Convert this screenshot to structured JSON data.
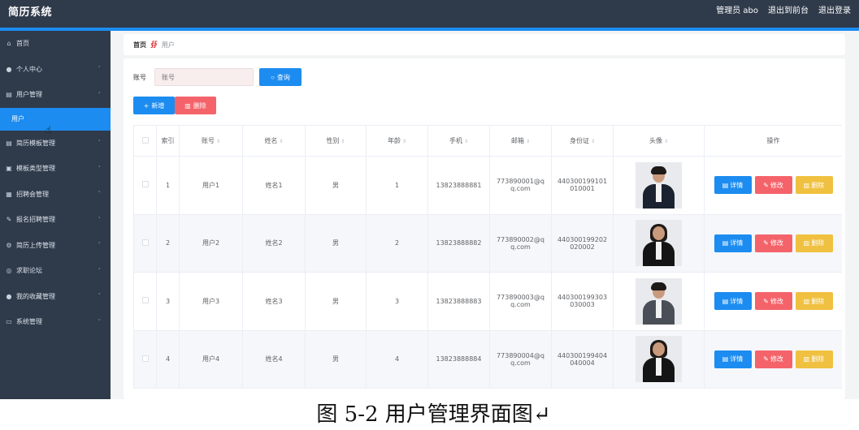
{
  "header": {
    "brand": "简历系统",
    "admin": "管理员 abo",
    "front": "退出到前台",
    "logout": "退出登录"
  },
  "sidebar": {
    "items": [
      {
        "label": "首页",
        "icon": "home-icon",
        "chevron": ""
      },
      {
        "label": "个人中心",
        "icon": "person-icon",
        "chevron": "˅"
      },
      {
        "label": "用户管理",
        "icon": "list-icon",
        "chevron": "˄"
      },
      {
        "label": "用户",
        "icon": "",
        "chevron": "",
        "sub": true
      },
      {
        "label": "简历模板管理",
        "icon": "list-icon",
        "chevron": "˅"
      },
      {
        "label": "模板类型管理",
        "icon": "briefcase-icon",
        "chevron": "˅"
      },
      {
        "label": "招聘会管理",
        "icon": "calendar-icon",
        "chevron": "˅"
      },
      {
        "label": "报名招聘管理",
        "icon": "edit-icon",
        "chevron": "˅"
      },
      {
        "label": "简历上传管理",
        "icon": "gear-icon",
        "chevron": "˅"
      },
      {
        "label": "求职论坛",
        "icon": "compass-icon",
        "chevron": "˅"
      },
      {
        "label": "我的收藏管理",
        "icon": "person-icon",
        "chevron": "˅"
      },
      {
        "label": "系统管理",
        "icon": "chat-icon",
        "chevron": "˅"
      }
    ]
  },
  "breadcrumb": {
    "home": "首页",
    "current": "用户"
  },
  "search": {
    "label": "账号",
    "placeholder": "账号",
    "button": "查询"
  },
  "actions": {
    "add": "新增",
    "delete": "删除"
  },
  "table": {
    "columns": [
      "索引",
      "账号",
      "姓名",
      "性别",
      "年龄",
      "手机",
      "邮箱",
      "身份证",
      "头像",
      "操作"
    ],
    "rows": [
      {
        "index": "1",
        "account": "用户1",
        "name": "姓名1",
        "gender": "男",
        "age": "1",
        "phone": "13823888881",
        "email_a": "773890001@q",
        "email_b": "q.com",
        "id_a": "440300199101",
        "id_b": "010001"
      },
      {
        "index": "2",
        "account": "用户2",
        "name": "姓名2",
        "gender": "男",
        "age": "2",
        "phone": "13823888882",
        "email_a": "773890002@q",
        "email_b": "q.com",
        "id_a": "440300199202",
        "id_b": "020002"
      },
      {
        "index": "3",
        "account": "用户3",
        "name": "姓名3",
        "gender": "男",
        "age": "3",
        "phone": "13823888883",
        "email_a": "773890003@q",
        "email_b": "q.com",
        "id_a": "440300199303",
        "id_b": "030003"
      },
      {
        "index": "4",
        "account": "用户4",
        "name": "姓名4",
        "gender": "男",
        "age": "4",
        "phone": "13823888884",
        "email_a": "773890004@q",
        "email_b": "q.com",
        "id_a": "440300199404",
        "id_b": "040004"
      }
    ],
    "ops": {
      "detail": "详情",
      "edit": "修改",
      "delete": "删除"
    }
  },
  "caption": "图 5-2 用户管理界面图↵",
  "colors": {
    "topbar": "#2f3a4a",
    "accent": "#1c8cf0",
    "danger": "#f5636a",
    "warning": "#f0c040"
  }
}
